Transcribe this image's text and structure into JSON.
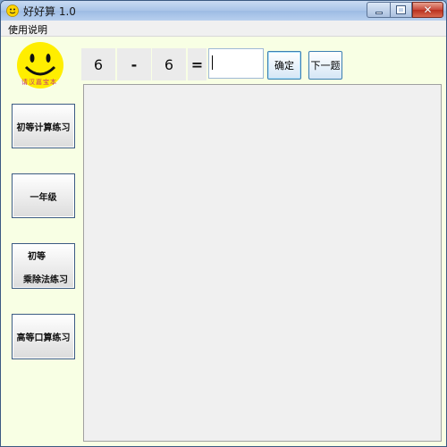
{
  "window": {
    "title": "好好算  1.0"
  },
  "menu": {
    "items": [
      "使用说明"
    ]
  },
  "logo": {
    "text": "请汉嘉宝本"
  },
  "sidebar": {
    "buttons": [
      {
        "label": "初等计算练习"
      },
      {
        "label": "一年级"
      },
      {
        "label_line1": "初等",
        "label_line2": "乘除法练习"
      },
      {
        "label": "高等口算练习"
      }
    ]
  },
  "question": {
    "operand1": "6",
    "operator": "-",
    "operand2": "6",
    "equals": "=",
    "answer_value": ""
  },
  "actions": {
    "confirm_label": "确定",
    "next_label": "下一题"
  },
  "colors": {
    "window_bg": "#f8ffe4",
    "titlebar": "#a9c4e8",
    "close_button": "#c8483a",
    "logo_face": "#ffee00"
  }
}
